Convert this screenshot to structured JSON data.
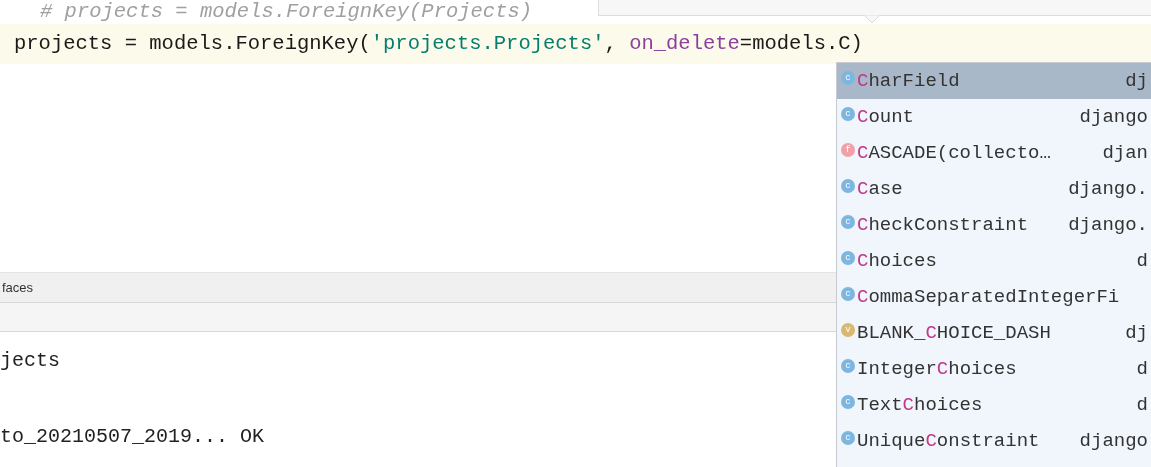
{
  "editor": {
    "comment": "# projects = models.ForeignKey(Projects)",
    "current_line": {
      "start": "projects = models.ForeignKey(",
      "string": "'projects.Projects'",
      "comma": ", ",
      "keyword": "on_delete",
      "rest": "=models.C)"
    }
  },
  "completion": {
    "items": [
      {
        "kind": "class",
        "badge": "c",
        "match": "C",
        "after": "harField",
        "location": "dj",
        "selected": true
      },
      {
        "kind": "class",
        "badge": "c",
        "match": "C",
        "after": "ount",
        "location": "django",
        "selected": false
      },
      {
        "kind": "function",
        "badge": "f",
        "match": "C",
        "after": "ASCADE(collecto…",
        "location": "djan",
        "selected": false
      },
      {
        "kind": "class",
        "badge": "c",
        "match": "C",
        "after": "ase",
        "location": "django.",
        "selected": false
      },
      {
        "kind": "class",
        "badge": "c",
        "match": "C",
        "after": "heckConstraint",
        "location": "django.",
        "selected": false
      },
      {
        "kind": "class",
        "badge": "c",
        "match": "C",
        "after": "hoices",
        "location": "d",
        "selected": false
      },
      {
        "kind": "class",
        "badge": "c",
        "match": "C",
        "after": "ommaSeparatedIntegerFi",
        "selected": false
      },
      {
        "kind": "variable",
        "badge": "v",
        "before": "BLANK_",
        "match": "C",
        "after": "HOICE_DASH",
        "location": "dj",
        "selected": false
      },
      {
        "kind": "class",
        "badge": "c",
        "before": "Integer",
        "match": "C",
        "after": "hoices",
        "location": "d",
        "selected": false
      },
      {
        "kind": "class",
        "badge": "c",
        "before": "Text",
        "match": "C",
        "after": "hoices",
        "location": "d",
        "selected": false
      },
      {
        "kind": "class",
        "badge": "c",
        "before": "Unique",
        "match": "C",
        "after": "onstraint",
        "location": "django",
        "selected": false
      }
    ]
  },
  "tool_window": {
    "tab": "faces"
  },
  "output": [
    "jects",
    "to_20210507_2019... OK"
  ]
}
